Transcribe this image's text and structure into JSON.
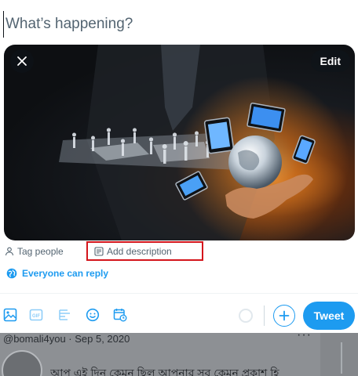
{
  "composer": {
    "placeholder": "What’s happening?",
    "media": {
      "edit_label": "Edit"
    },
    "actions": {
      "tag_people": "Tag people",
      "add_description": "Add description"
    },
    "reply_setting": "Everyone can reply",
    "toolbar": {
      "tools": [
        "media-icon",
        "gif-icon",
        "poll-icon",
        "emoji-icon",
        "schedule-icon"
      ],
      "tweet_label": "Tweet"
    }
  },
  "background_timeline": {
    "meta": "@bomali4you · Sep 5, 2020",
    "more": "···",
    "text": "আপ এই দিন কেমন ছিল আপনার সব কেমন প্রকাশ হি"
  },
  "colors": {
    "accent": "#1d9bf0",
    "highlight_border": "#d4151c",
    "secondary_text": "#536471"
  }
}
